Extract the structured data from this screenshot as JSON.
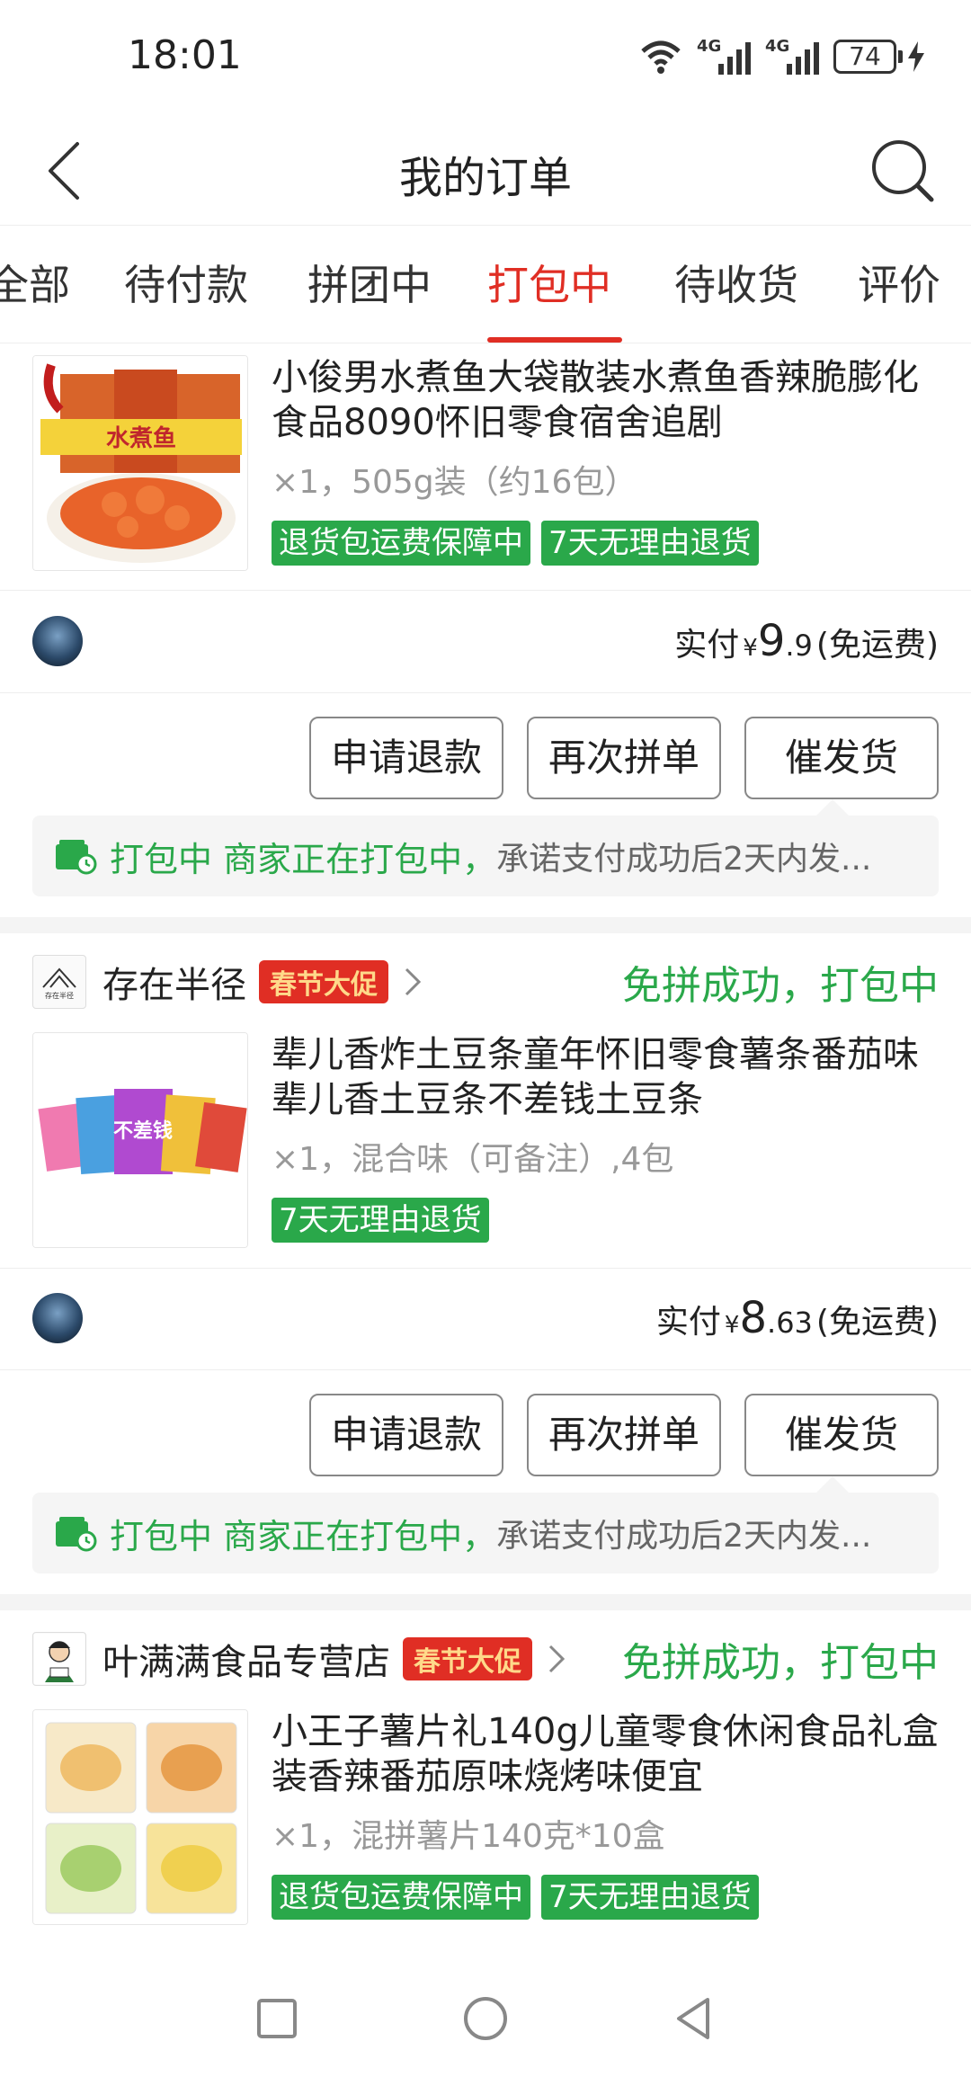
{
  "status_bar": {
    "time": "18:01",
    "network_1": "4G",
    "network_2": "4G",
    "battery": "74",
    "icons": [
      "wifi-icon",
      "signal-icon",
      "signal-icon",
      "battery-icon",
      "charging-icon"
    ]
  },
  "nav": {
    "title": "我的订单",
    "back_icon": "back-arrow-icon",
    "search_icon": "search-icon"
  },
  "tabs": [
    {
      "label": "全部",
      "active": false
    },
    {
      "label": "待付款",
      "active": false
    },
    {
      "label": "拼团中",
      "active": false
    },
    {
      "label": "打包中",
      "active": true
    },
    {
      "label": "待收货",
      "active": false
    },
    {
      "label": "评价",
      "active": false
    }
  ],
  "orders": [
    {
      "product": {
        "title": "小俊男水煮鱼大袋散装水煮鱼香辣脆膨化食品8090怀旧零食宿舍追剧",
        "spec": "×1，505g装（约16包）",
        "tags": [
          "退货包运费保障中",
          "7天无理由退货"
        ],
        "thumb_label": "水煮鱼"
      },
      "payment": {
        "label": "实付",
        "currency": "¥",
        "int": "9",
        "dec": ".9",
        "note": "(免运费)"
      },
      "buttons": [
        "申请退款",
        "再次拼单",
        "催发货"
      ],
      "notice": {
        "status": "打包中 商家正在打包中，",
        "text": "承诺支付成功后2天内发..."
      }
    },
    {
      "store": {
        "name": "存在半径",
        "promo": "春节大促",
        "status": "免拼成功，打包中",
        "logo_text": "存在半径"
      },
      "product": {
        "title": "辈儿香炸土豆条童年怀旧零食薯条番茄味辈儿香土豆条不差钱土豆条",
        "spec": "×1，混合味（可备注）,4包",
        "tags": [
          "7天无理由退货"
        ],
        "thumb_label": "不差钱"
      },
      "payment": {
        "label": "实付",
        "currency": "¥",
        "int": "8",
        "dec": ".63",
        "note": "(免运费)"
      },
      "buttons": [
        "申请退款",
        "再次拼单",
        "催发货"
      ],
      "notice": {
        "status": "打包中 商家正在打包中，",
        "text": "承诺支付成功后2天内发..."
      }
    },
    {
      "store": {
        "name": "叶满满食品专营店",
        "promo": "春节大促",
        "status": "免拼成功，打包中"
      },
      "product": {
        "title": "小王子薯片礼140g儿童零食休闲食品礼盒装香辣番茄原味烧烤味便宜",
        "spec": "×1，混拼薯片140克*10盒",
        "tags": [
          "退货包运费保障中",
          "7天无理由退货"
        ]
      }
    }
  ],
  "colors": {
    "accent": "#e02e24",
    "green": "#2aa84a",
    "muted": "#999999"
  },
  "system_nav": [
    "recent-apps-icon",
    "home-icon",
    "back-icon"
  ]
}
